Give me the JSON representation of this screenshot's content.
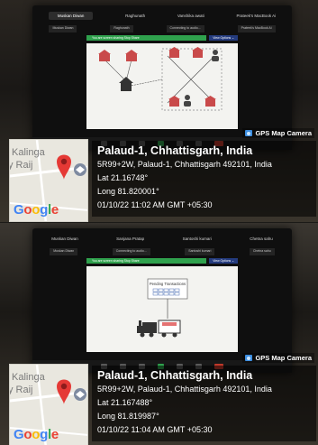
{
  "photos": [
    {
      "meeting": {
        "participants": [
          "Muskan Diwan",
          "Raghunath",
          "Vanshika awati",
          "Prateek's MacBook Ai"
        ],
        "tiles": [
          "Muskan Diwan",
          "Raghunath",
          "Connecting to audio...",
          "Prateek's MacBook Ai"
        ],
        "share_text": "You are screen sharing  Stop Share",
        "view_options": "View Options ⌄"
      },
      "stamp": {
        "title": "GPS Map Camera",
        "map_labels": [
          "Kalinga",
          "y Raij"
        ],
        "map_logo": [
          "G",
          "o",
          "o",
          "g",
          "l",
          "e"
        ],
        "place": "Palaud-1, Chhattisgarh, India",
        "address": "5R99+2W, Palaud-1, Chhattisgarh 492101, India",
        "lat": "Lat 21.16748°",
        "long": "Long 81.820001°",
        "datetime": "01/10/22 11:02 AM GMT +05:30"
      }
    },
    {
      "meeting": {
        "participants": [
          "Muskan Diwan",
          "Sanjana Pratap",
          "Santoshi kumari",
          "Chetna sahu"
        ],
        "tiles": [
          "Muskan Diwan",
          "Connecting to audio...",
          "Santoshi kumari",
          "Chetna sahu"
        ],
        "share_text": "You are screen sharing  Stop Share",
        "view_options": "View Options ⌄",
        "slide_label": "Pending Transactions"
      },
      "stamp": {
        "title": "GPS Map Camera",
        "map_labels": [
          "Kalinga",
          "y Raij"
        ],
        "map_logo": [
          "G",
          "o",
          "o",
          "g",
          "l",
          "e"
        ],
        "place": "Palaud-1, Chhattisgarh, India",
        "address": "5R99+2W, Palaud-1, Chhattisgarh 492101, India",
        "lat": "Lat 21.167488°",
        "long": "Long 81.819987°",
        "datetime": "01/10/22 11:04 AM GMT +05:30"
      }
    }
  ],
  "colors": {
    "accent": "#2fa14d",
    "pin": "#e53935",
    "view_button": "#243b7e"
  }
}
